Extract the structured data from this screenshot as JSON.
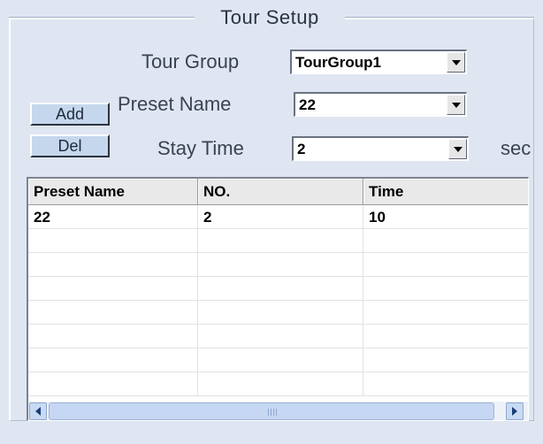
{
  "panel": {
    "title": "Tour Setup"
  },
  "form": {
    "tour_group_label": "Tour Group",
    "tour_group_value": "TourGroup1",
    "preset_name_label": "Preset Name",
    "preset_name_value": "22",
    "stay_time_label": "Stay Time",
    "stay_time_value": "2",
    "stay_time_unit": "sec"
  },
  "buttons": {
    "add": "Add",
    "del": "Del"
  },
  "table": {
    "columns": [
      "Preset Name",
      "NO.",
      "Time"
    ],
    "rows": [
      [
        "22",
        "2",
        "10"
      ]
    ]
  },
  "icons": {
    "dropdown": "chevron-down-icon",
    "scroll_left": "arrow-left-icon",
    "scroll_right": "arrow-right-icon"
  }
}
